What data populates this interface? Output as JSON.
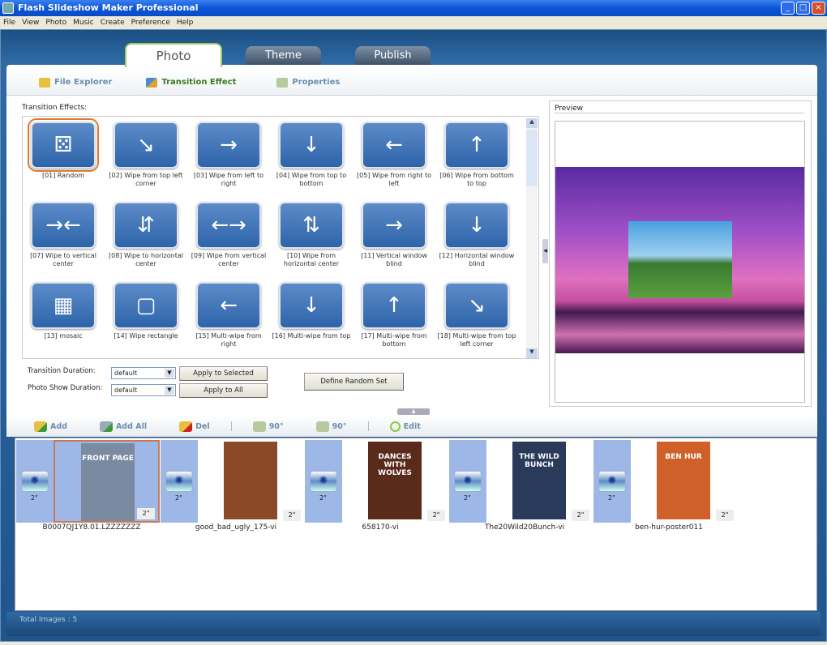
{
  "window": {
    "title": "Flash Slideshow Maker Professional",
    "controls": [
      "_",
      "□",
      "×"
    ]
  },
  "menu": [
    "File",
    "View",
    "Photo",
    "Music",
    "Create",
    "Preference",
    "Help"
  ],
  "main_tabs": [
    {
      "label": "Photo",
      "active": true
    },
    {
      "label": "Theme"
    },
    {
      "label": "Publish"
    }
  ],
  "sub_tabs": [
    {
      "label": "File Explorer"
    },
    {
      "label": "Transition Effect",
      "active": true
    },
    {
      "label": "Properties"
    }
  ],
  "effects": {
    "label": "Transition Effects:",
    "items": [
      {
        "label": "[01] Random",
        "icon": "⚄",
        "selected": true
      },
      {
        "label": "[02] Wipe from top left corner",
        "icon": "↘"
      },
      {
        "label": "[03] Wipe from left to right",
        "icon": "→"
      },
      {
        "label": "[04] Wipe from top to bottom",
        "icon": "↓"
      },
      {
        "label": "[05] Wipe from right to left",
        "icon": "←"
      },
      {
        "label": "[06] Wipe from bottom to top",
        "icon": "↑"
      },
      {
        "label": "[07] Wipe to vertical center",
        "icon": "→←"
      },
      {
        "label": "[08] Wipe to horizontal center",
        "icon": "⇵"
      },
      {
        "label": "[09] Wipe from vertical center",
        "icon": "←→"
      },
      {
        "label": "[10] Wipe from horizontal center",
        "icon": "⇅"
      },
      {
        "label": "[11] Vertical window blind",
        "icon": "→"
      },
      {
        "label": "[12] Horizontal window blind",
        "icon": "↓"
      },
      {
        "label": "[13] mosaic",
        "icon": "▦"
      },
      {
        "label": "[14] Wipe rectangle",
        "icon": "▢"
      },
      {
        "label": "[15] Multi-wipe from right",
        "icon": "←"
      },
      {
        "label": "[16] Multi-wipe from top",
        "icon": "↓"
      },
      {
        "label": "[17] Multi-wipe from bottom",
        "icon": "↑"
      },
      {
        "label": "[18] Multi-wipe from top left corner",
        "icon": "↘"
      }
    ]
  },
  "controls": {
    "transition_duration_label": "Transition Duration:",
    "transition_duration_value": "default",
    "photo_duration_label": "Photo Show Duration:",
    "photo_duration_value": "default",
    "apply_selected": "Apply to Selected",
    "apply_all": "Apply to All",
    "define_random": "Define Random Set"
  },
  "preview": {
    "label": "Preview"
  },
  "toolbar": {
    "add": "Add",
    "add_all": "Add All",
    "del": "Del",
    "rotate_left": "90°",
    "rotate_right": "90°",
    "edit": "Edit"
  },
  "filmstrip": [
    {
      "name": "B0007QJ1Y8.01.LZZZZZZZ",
      "duration": "2\"",
      "transition_duration": "2\"",
      "selected": true,
      "poster_text": "FRONT PAGE",
      "color": "#7a8aa0"
    },
    {
      "name": "good_bad_ugly_175-vi",
      "duration": "2\"",
      "transition_duration": "2\"",
      "poster_text": "",
      "color": "#8a4a2a"
    },
    {
      "name": "658170-vi",
      "duration": "2\"",
      "transition_duration": "2\"",
      "poster_text": "DANCES WITH WOLVES",
      "color": "#5a2a1a"
    },
    {
      "name": "The20Wild20Bunch-vi",
      "duration": "2\"",
      "transition_duration": "2\"",
      "poster_text": "THE WILD BUNCH",
      "color": "#2a3a5a"
    },
    {
      "name": "ben-hur-poster011",
      "duration": "2\"",
      "transition_duration": "2\"",
      "poster_text": "BEN HUR",
      "color": "#d0602a"
    }
  ],
  "status": {
    "text": "Total Images : 5"
  }
}
